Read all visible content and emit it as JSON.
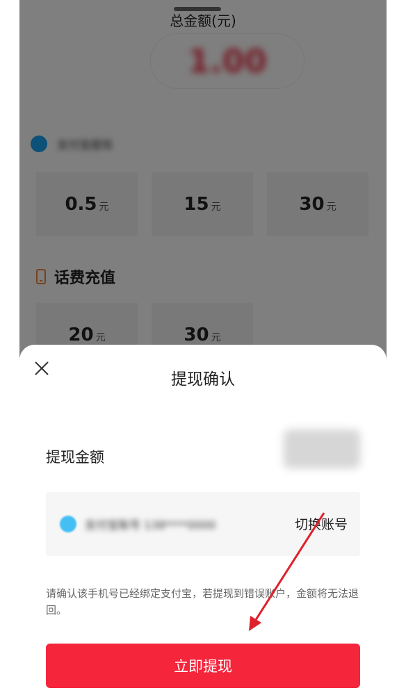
{
  "background_page": {
    "total_label": "总金额(元)",
    "total_value": "1.00",
    "alipay_section_label": "支付宝提现",
    "alipay_options": [
      {
        "amount": "0.5",
        "unit": "元"
      },
      {
        "amount": "15",
        "unit": "元"
      },
      {
        "amount": "30",
        "unit": "元"
      }
    ],
    "phone_section_title": "话费充值",
    "phone_options": [
      {
        "amount": "20",
        "unit": "元"
      },
      {
        "amount": "30",
        "unit": "元"
      }
    ]
  },
  "dialog": {
    "title": "提现确认",
    "close_icon": "close-icon",
    "amount_label": "提现金额",
    "amount_value": "1.00元",
    "account_name": "支付宝账号 138****0000",
    "switch_account_label": "切换账号",
    "notice_text": "请确认该手机号已经绑定支付宝，若提现到错误账户，金额将无法退回。",
    "withdraw_button_label": "立即提现"
  },
  "colors": {
    "brand_red": "#f5253c",
    "alipay_blue": "#1aa1f0",
    "phone_icon_orange": "#f0843c",
    "annotation_arrow": "#e0202a"
  }
}
